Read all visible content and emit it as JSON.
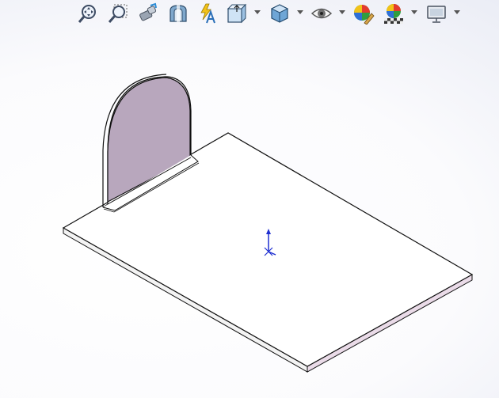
{
  "toolbar": {
    "items": [
      {
        "name": "zoom-to-fit-icon",
        "dropdown": false
      },
      {
        "name": "zoom-to-area-icon",
        "dropdown": false
      },
      {
        "name": "previous-view-icon",
        "dropdown": false
      },
      {
        "name": "section-view-icon",
        "dropdown": false
      },
      {
        "name": "dynamic-annotation-views-icon",
        "dropdown": false
      },
      {
        "name": "view-orientation-icon",
        "dropdown": true
      },
      {
        "name": "display-style-icon",
        "dropdown": true
      },
      {
        "name": "hide-show-items-icon",
        "dropdown": true
      },
      {
        "name": "edit-appearance-icon",
        "dropdown": false
      },
      {
        "name": "apply-scene-icon",
        "dropdown": true
      },
      {
        "name": "view-settings-icon",
        "dropdown": true
      }
    ]
  },
  "model": {
    "base_plate_color": "#ffffff",
    "wall_face_color": "#b8a7bd",
    "edge_color": "#111111",
    "triad_color": "#1f2fd0"
  }
}
